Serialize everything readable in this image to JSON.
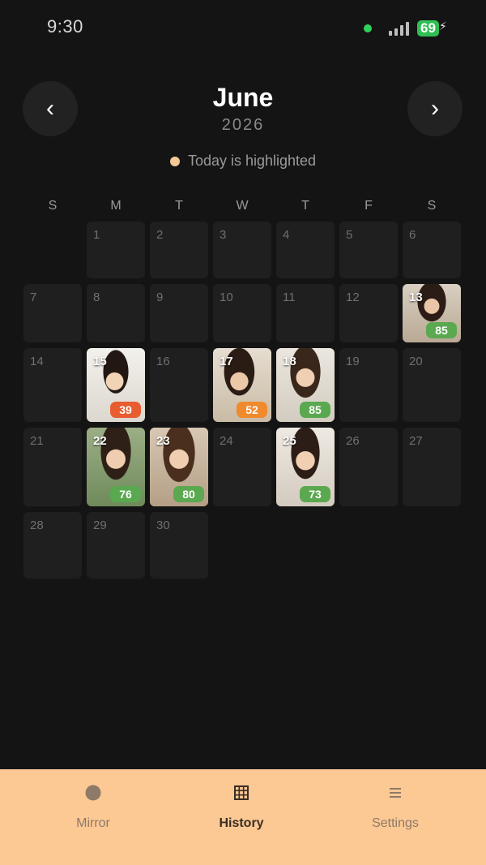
{
  "status": {
    "time": "9:30",
    "battery": "69",
    "battery_color": "#2fbf53"
  },
  "calendar": {
    "month": "June",
    "year": "2026",
    "legend_text": "Today is highlighted",
    "legend_color": "#f5c996",
    "weekdays": [
      "S",
      "M",
      "T",
      "W",
      "T",
      "F",
      "S"
    ],
    "days": [
      {
        "n": "1"
      },
      {
        "n": "2"
      },
      {
        "n": "3"
      },
      {
        "n": "4"
      },
      {
        "n": "5"
      },
      {
        "n": "6"
      },
      {
        "n": "7"
      },
      {
        "n": "8"
      },
      {
        "n": "9"
      },
      {
        "n": "10"
      },
      {
        "n": "11"
      },
      {
        "n": "12"
      },
      {
        "n": "13",
        "score": "85",
        "score_color": "#5aa84f"
      },
      {
        "n": "14"
      },
      {
        "n": "15",
        "score": "39",
        "score_color": "#e85d2f"
      },
      {
        "n": "16"
      },
      {
        "n": "17",
        "score": "52",
        "score_color": "#f08a2c"
      },
      {
        "n": "18",
        "score": "85",
        "score_color": "#5aa84f"
      },
      {
        "n": "19"
      },
      {
        "n": "20"
      },
      {
        "n": "21"
      },
      {
        "n": "22",
        "score": "76",
        "score_color": "#5aa84f"
      },
      {
        "n": "23",
        "score": "80",
        "score_color": "#5aa84f",
        "today": true
      },
      {
        "n": "24"
      },
      {
        "n": "25",
        "score": "73",
        "score_color": "#5aa84f"
      },
      {
        "n": "26"
      },
      {
        "n": "27"
      },
      {
        "n": "28"
      },
      {
        "n": "29"
      },
      {
        "n": "30"
      }
    ]
  },
  "tabbar": {
    "tabs": [
      {
        "label": "Mirror",
        "icon": "circle-icon",
        "active": false
      },
      {
        "label": "History",
        "icon": "grid-icon",
        "active": true
      },
      {
        "label": "Settings",
        "icon": "menu-icon",
        "active": false
      }
    ]
  }
}
